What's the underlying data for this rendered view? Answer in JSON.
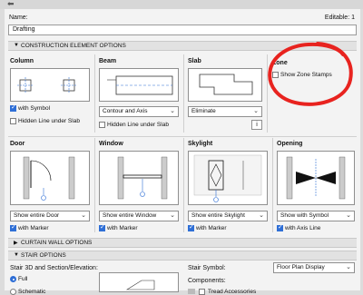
{
  "header": {
    "name_label": "Name:",
    "editable_text": "Editable: 1",
    "name_value": "Drafting"
  },
  "sections": {
    "construction": "CONSTRUCTION ELEMENT OPTIONS",
    "curtain": "CURTAIN WALL OPTIONS",
    "stair": "STAIR OPTIONS"
  },
  "column": {
    "title": "Column",
    "with_symbol": "with Symbol",
    "hidden_line": "Hidden Line under Slab"
  },
  "beam": {
    "title": "Beam",
    "dropdown": "Contour and Axis",
    "hidden_line": "Hidden Line under Slab"
  },
  "slab": {
    "title": "Slab",
    "dropdown": "Eliminate"
  },
  "zone": {
    "title": "Zone",
    "show_stamps": "Show Zone Stamps"
  },
  "door": {
    "title": "Door",
    "dropdown": "Show entire Door",
    "with_marker": "with Marker"
  },
  "window": {
    "title": "Window",
    "dropdown": "Show entire Window",
    "with_marker": "with Marker"
  },
  "skylight": {
    "title": "Skylight",
    "dropdown": "Show entire Skylight",
    "with_marker": "with Marker"
  },
  "opening": {
    "title": "Opening",
    "dropdown": "Show with Symbol",
    "with_axis": "with Axis Line"
  },
  "stair": {
    "left_title": "Stair 3D and Section/Elevation:",
    "opt_full": "Full",
    "opt_schematic": "Schematic",
    "symbol_label": "Stair Symbol:",
    "symbol_value": "Floor Plan Display",
    "components_label": "Components:",
    "tread_accessories": "Tread Accessories"
  },
  "icons": {
    "collapse": "triangle-down-icon",
    "info": "info-icon",
    "chevron": "chevron-down-icon"
  },
  "colors": {
    "annotation_red": "#e8231f",
    "checkbox_blue": "#2f6fd6"
  }
}
